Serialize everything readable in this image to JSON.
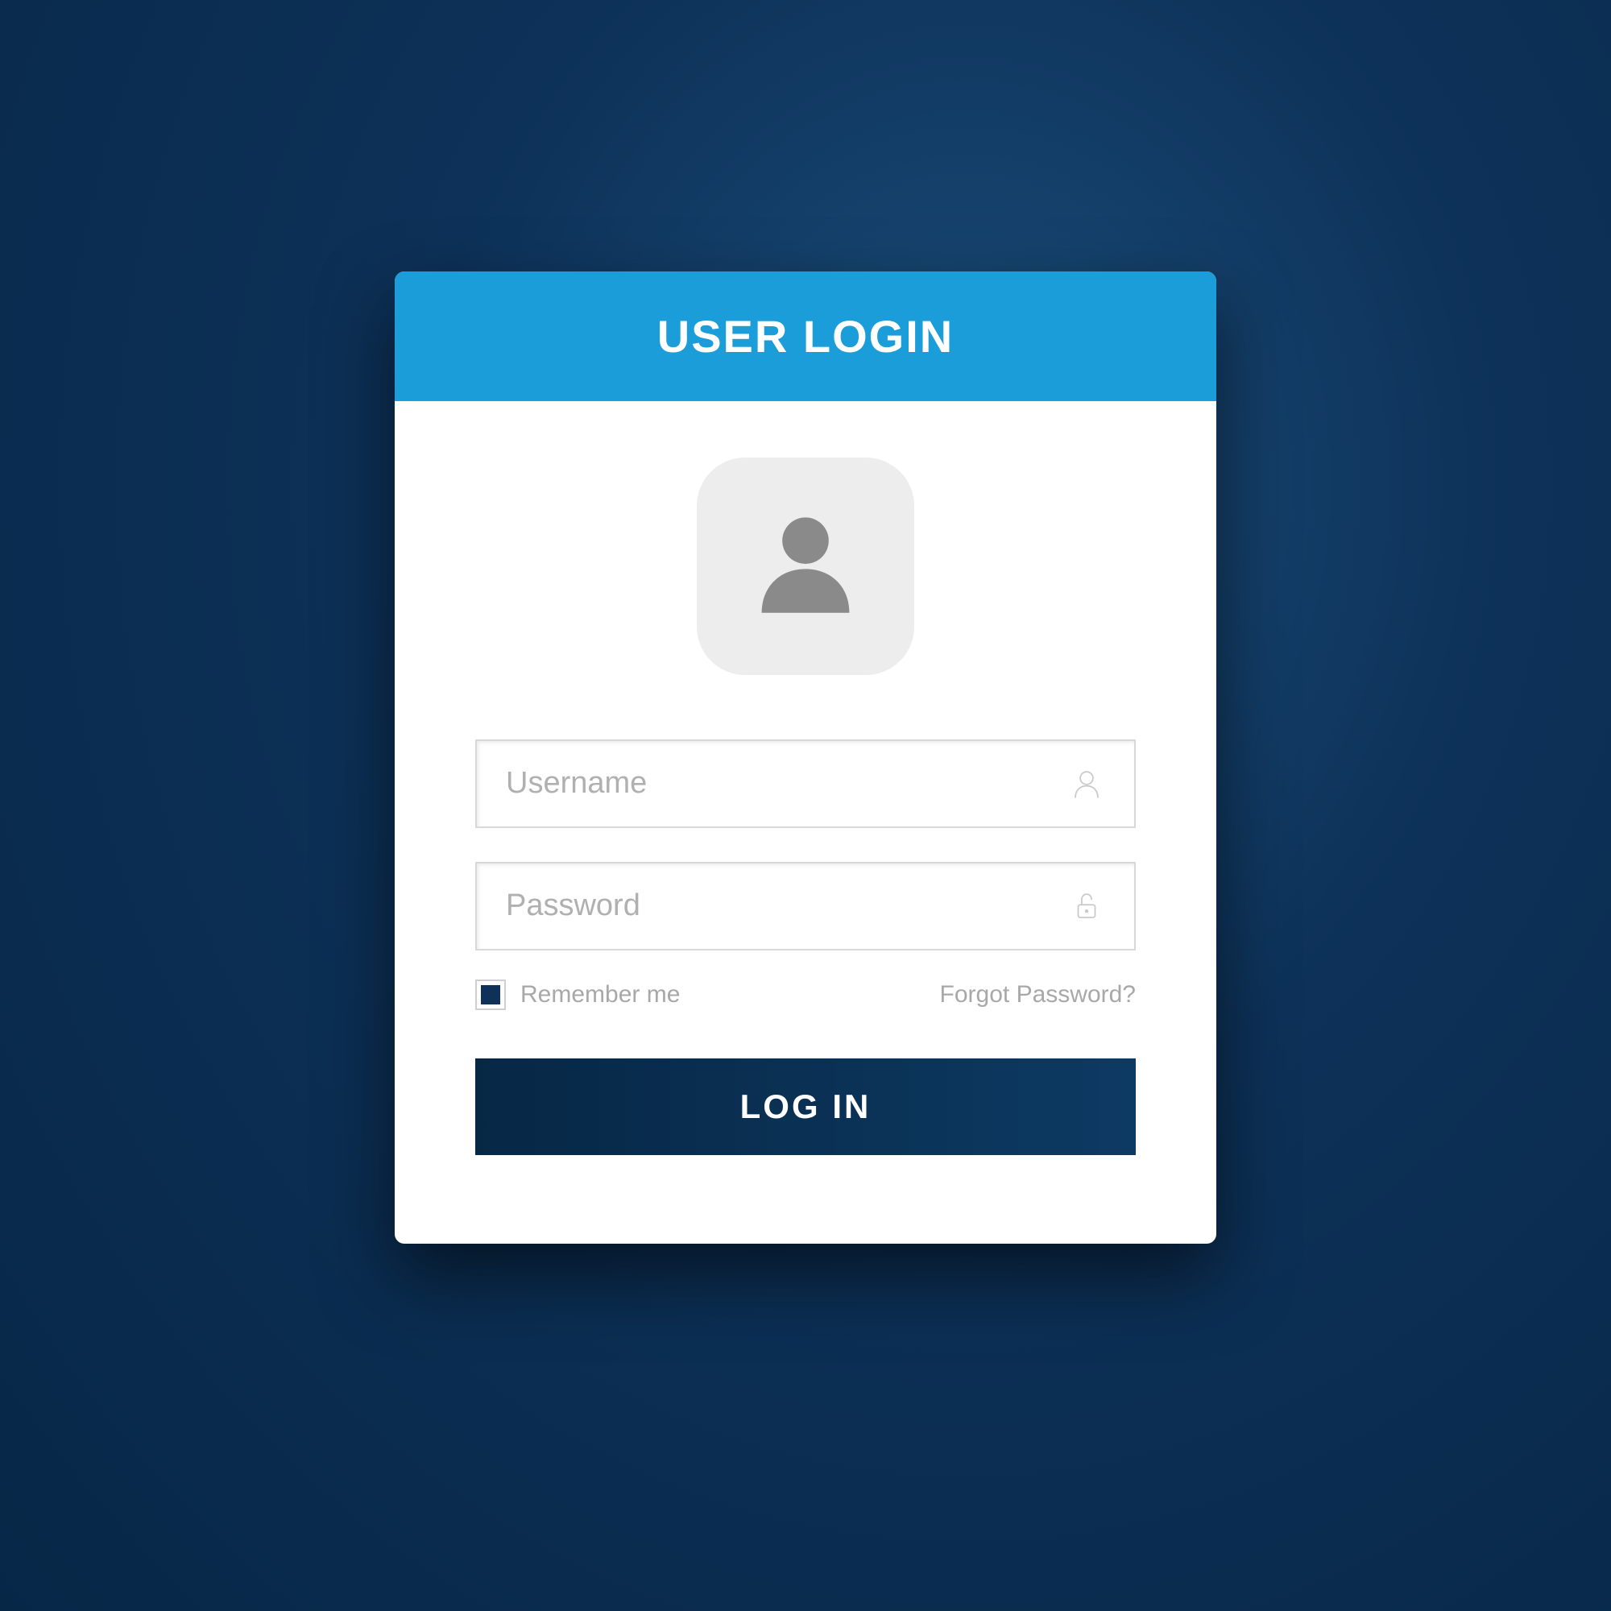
{
  "header": {
    "title": "USER LOGIN"
  },
  "avatar": {
    "icon": "user-icon"
  },
  "fields": {
    "username": {
      "placeholder": "Username",
      "value": "",
      "icon": "person-icon"
    },
    "password": {
      "placeholder": "Password",
      "value": "",
      "icon": "lock-icon"
    }
  },
  "options": {
    "remember_label": "Remember me",
    "remember_checked": true,
    "forgot_label": "Forgot Password?"
  },
  "actions": {
    "login_label": "LOG IN"
  },
  "colors": {
    "accent": "#1b9dd9",
    "dark": "#0d3158",
    "background": "#072747"
  }
}
